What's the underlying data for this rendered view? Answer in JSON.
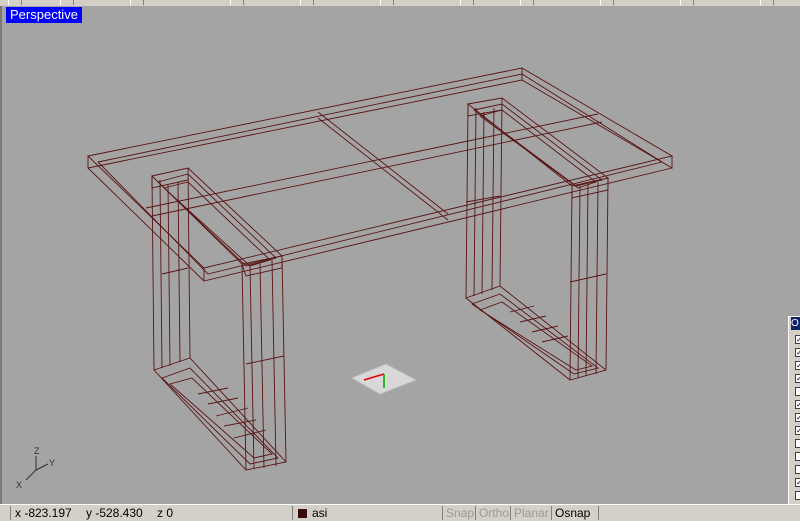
{
  "viewport": {
    "label": "Perspective"
  },
  "axes": {
    "z": "Z",
    "y": "Y",
    "x": "X"
  },
  "osnap": {
    "title": "O",
    "checks": [
      true,
      true,
      true,
      true,
      false,
      true,
      true,
      true,
      false,
      false,
      false,
      true,
      false
    ]
  },
  "status": {
    "x": "x -823.197",
    "y": "y -528.430",
    "z": "z 0",
    "layer": "asi",
    "snap": "Snap",
    "ortho": "Ortho",
    "planar": "Planar",
    "osnap": "Osnap"
  },
  "colors": {
    "wire": "#5a1414",
    "viewport_bg": "#a4a4a4",
    "label_bg": "#0000ff",
    "layer": "#3a0a0a"
  }
}
